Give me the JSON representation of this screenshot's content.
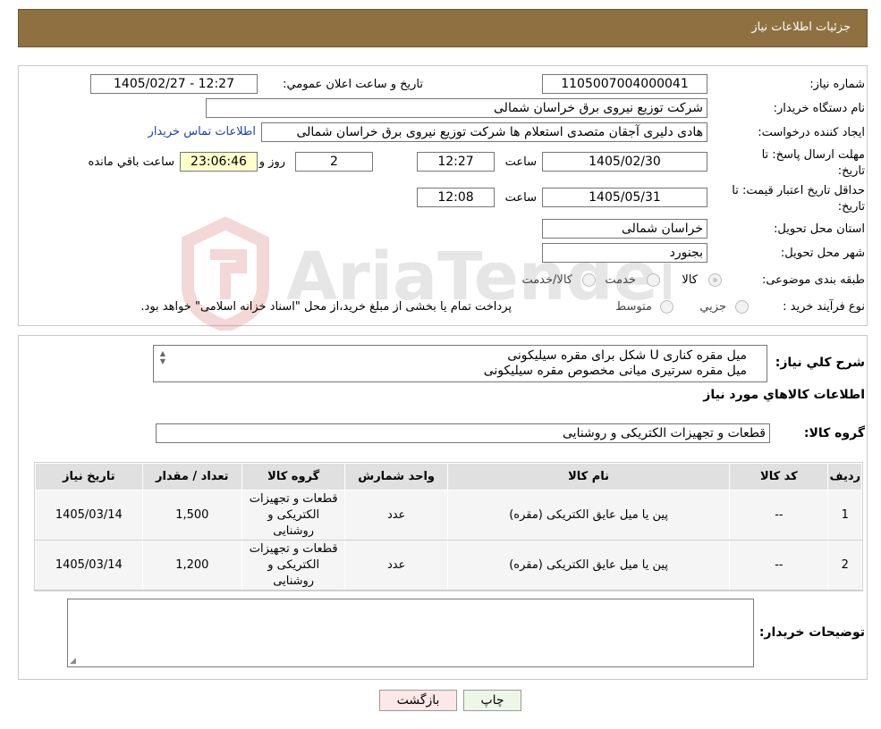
{
  "header": {
    "title": "جزئیات اطلاعات نیاز"
  },
  "form": {
    "need_number": {
      "label": "شماره نیاز:",
      "value": "1105007004000041"
    },
    "announce": {
      "label": "تاریخ و ساعت اعلان عمومي:",
      "value": "1405/02/27 - 12:27"
    },
    "buyer_org": {
      "label": "نام دستگاه خریدار:",
      "value": "شرکت توزیع نیروی برق خراسان شمالی"
    },
    "creator": {
      "label": "ایجاد کننده درخواست:",
      "value": "هادی دلیری آجقان متصدی استعلام ها شرکت توزیع نیروی برق خراسان شمالی",
      "contact_link": "اطلاعات تماس خریدار"
    },
    "reply_deadline": {
      "label_line1": "مهلت ارسال پاسخ: تا",
      "label_line2": "تاریخ:",
      "date": "1405/02/30",
      "time_label": "ساعت",
      "time": "12:27",
      "days": "2",
      "days_label": "روز و",
      "remaining": "23:06:46",
      "remaining_label": "ساعت باقي مانده"
    },
    "price_validity": {
      "label_line1": "حداقل تاریخ اعتبار قیمت: تا",
      "label_line2": "تاریخ:",
      "date": "1405/05/31",
      "time_label": "ساعت",
      "time": "12:08"
    },
    "province": {
      "label": "استان محل تحویل:",
      "value": "خراسان شمالی"
    },
    "city": {
      "label": "شهر محل تحویل:",
      "value": "بجنورد"
    },
    "category": {
      "label": "طبقه بندی موضوعی:",
      "options": [
        "کالا",
        "خدمت",
        "کالا/خدمت"
      ]
    },
    "process": {
      "label": "نوع فرآیند خرید :",
      "options": [
        "جزیي",
        "متوسط"
      ],
      "note": "پرداخت تمام یا بخشی از مبلغ خرید،از محل \"اسناد خزانه اسلامی\" خواهد بود."
    }
  },
  "details": {
    "summary_label": "شرح کلي نياز:",
    "summary_lines": [
      "میل مقره کناری U شکل برای مقره سیلیکونی",
      "میل مقره سرتیری میانی مخصوص مقره سیلیکونی"
    ],
    "goods_info_title": "اطلاعات کالاهاي مورد نياز",
    "goods_group_label": "گروه کالا:",
    "goods_group_value": "قطعات و تجهیزات الکتریکی و روشنایی",
    "table": {
      "headers": [
        "رديف",
        "کد کالا",
        "نام کالا",
        "واحد شمارش",
        "گروه کالا",
        "تعداد / مقدار",
        "تاریخ نیاز"
      ],
      "rows": [
        {
          "row": "1",
          "code": "--",
          "name": "پین یا میل عایق الکتریکی (مقره)",
          "unit": "عدد",
          "group": "قطعات و تجهیزات الکتریکی و روشنایی",
          "qty": "1,500",
          "date": "1405/03/14"
        },
        {
          "row": "2",
          "code": "--",
          "name": "پین یا میل عایق الکتریکی (مقره)",
          "unit": "عدد",
          "group": "قطعات و تجهیزات الکتریکی و روشنایی",
          "qty": "1,200",
          "date": "1405/03/14"
        }
      ]
    },
    "buyer_notes_label": "توضیحات خریدار:",
    "buyer_notes_value": ""
  },
  "buttons": {
    "print": "چاپ",
    "back": "بازگشت"
  },
  "watermark_text": "AriaTender.neT",
  "colors": {
    "header_bg": "#8f7141",
    "remaining_bg": "#ffffcc",
    "back_btn_bg": "#fde8e8",
    "print_btn_bg": "#edf7e8",
    "link": "#1a3fb5"
  }
}
